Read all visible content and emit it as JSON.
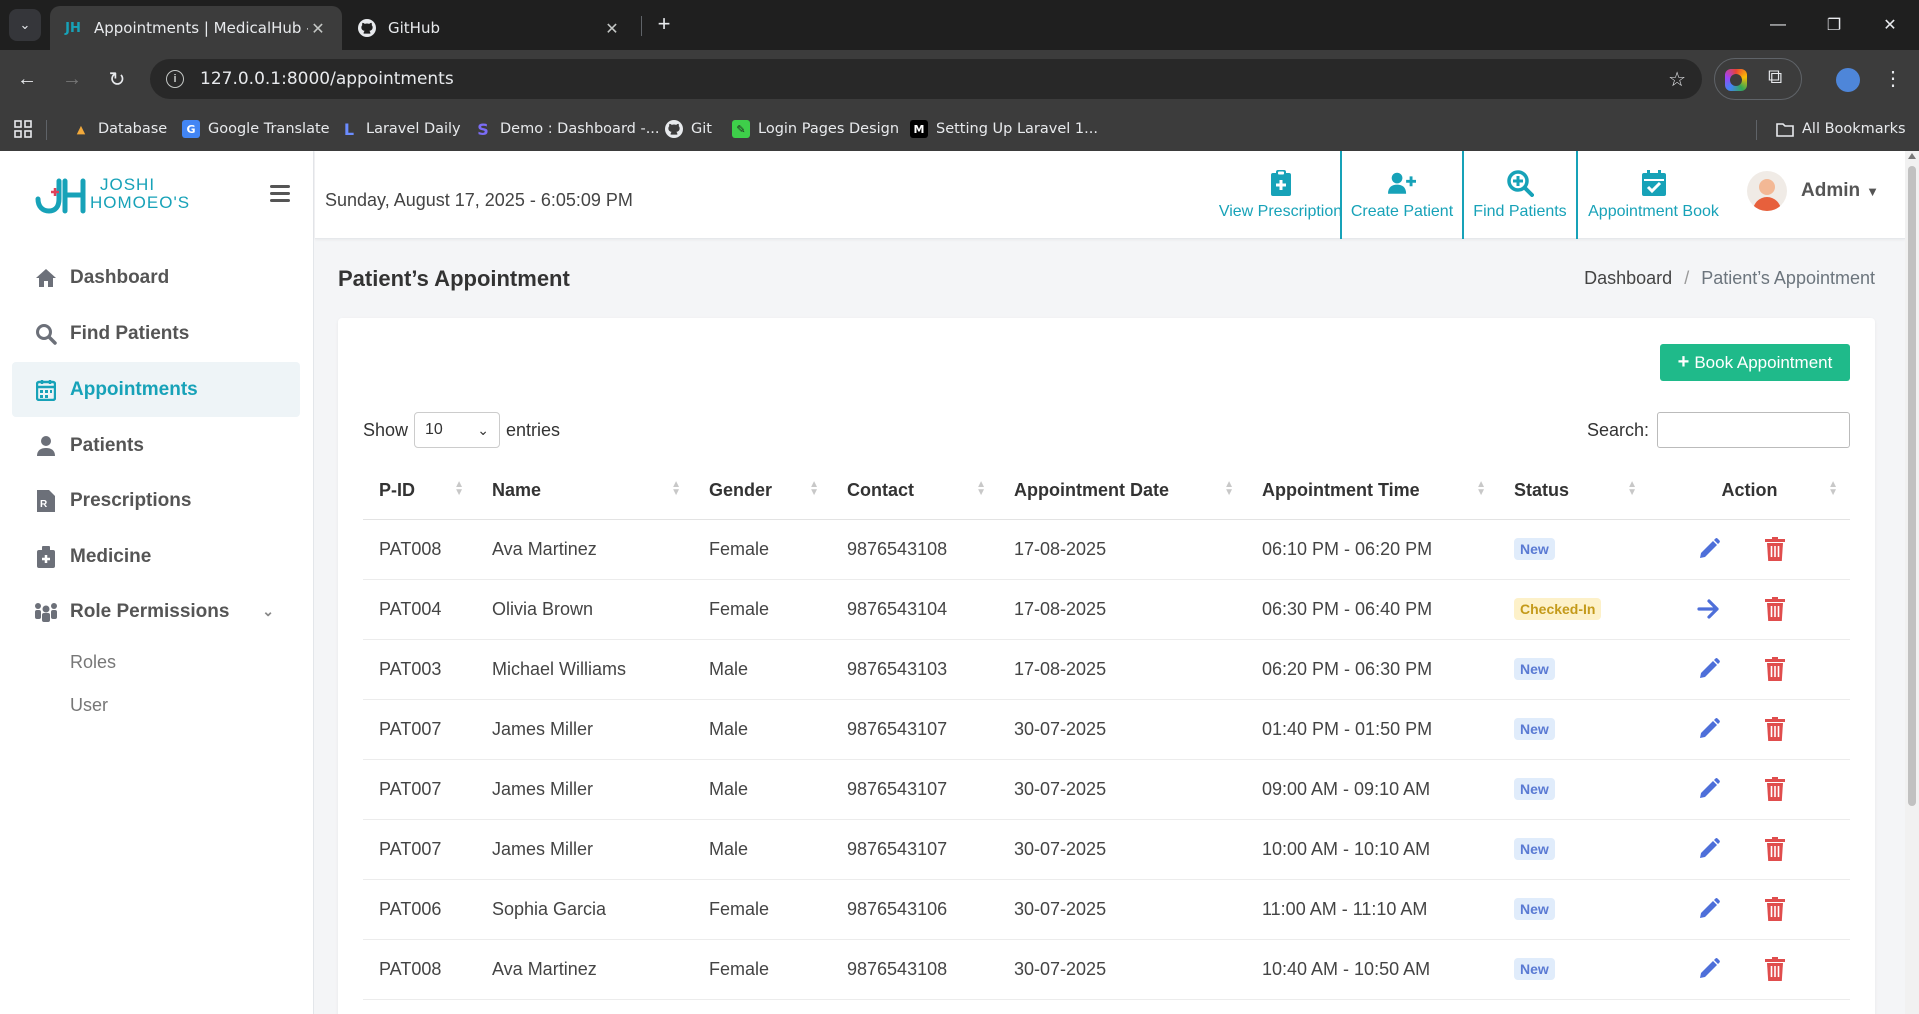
{
  "browser": {
    "tabs": [
      {
        "title": "Appointments | MedicalHub - A",
        "favicon": "jh-logo-icon"
      },
      {
        "title": "GitHub",
        "favicon": "github-icon"
      }
    ],
    "url": "127.0.0.1:8000/appointments",
    "bookmarks": [
      {
        "label": "Database",
        "icon": "database-icon"
      },
      {
        "label": "Google Translate",
        "icon": "translate-icon"
      },
      {
        "label": "Laravel Daily",
        "icon": "laravel-icon"
      },
      {
        "label": "Demo : Dashboard -...",
        "icon": "demo-icon"
      },
      {
        "label": "Git",
        "icon": "github-icon"
      },
      {
        "label": "Login Pages Design",
        "icon": "login-icon"
      },
      {
        "label": "Setting Up Laravel 1...",
        "icon": "medium-icon"
      }
    ],
    "all_bookmarks": "All Bookmarks"
  },
  "brand": {
    "line1": "JOSHI",
    "line2": "HOMOEO'S"
  },
  "sidebar": {
    "items": [
      {
        "label": "Dashboard",
        "icon": "home-icon"
      },
      {
        "label": "Find Patients",
        "icon": "search-icon"
      },
      {
        "label": "Appointments",
        "icon": "calendar-icon"
      },
      {
        "label": "Patients",
        "icon": "user-icon"
      },
      {
        "label": "Prescriptions",
        "icon": "prescription-icon"
      },
      {
        "label": "Medicine",
        "icon": "medkit-icon"
      },
      {
        "label": "Role Permissions",
        "icon": "people-icon"
      }
    ],
    "subitems": [
      {
        "label": "Roles"
      },
      {
        "label": "User"
      }
    ]
  },
  "topbar": {
    "datetime": "Sunday, August 17, 2025 - 6:05:09 PM",
    "actions": [
      {
        "label": "View Prescription",
        "icon": "clipboard-plus-icon"
      },
      {
        "label": "Create Patient",
        "icon": "user-plus-icon"
      },
      {
        "label": "Find Patients",
        "icon": "search-plus-icon"
      },
      {
        "label": "Appointment Book",
        "icon": "calendar-check-icon"
      }
    ],
    "user": "Admin"
  },
  "page": {
    "title": "Patient’s Appointment",
    "breadcrumb": {
      "home": "Dashboard",
      "separator": "/",
      "current": "Patient’s Appointment"
    },
    "book_button": "Book Appointment",
    "show_label": "Show",
    "entries_value": "10",
    "entries_label": "entries",
    "search_label": "Search:"
  },
  "table": {
    "columns": [
      "P-ID",
      "Name",
      "Gender",
      "Contact",
      "Appointment Date",
      "Appointment Time",
      "Status",
      "Action"
    ],
    "rows": [
      {
        "pid": "PAT008",
        "name": "Ava Martinez",
        "gender": "Female",
        "contact": "9876543108",
        "date": "17-08-2025",
        "time": "06:10 PM - 06:20 PM",
        "status": "New",
        "action": "edit"
      },
      {
        "pid": "PAT004",
        "name": "Olivia Brown",
        "gender": "Female",
        "contact": "9876543104",
        "date": "17-08-2025",
        "time": "06:30 PM - 06:40 PM",
        "status": "Checked-In",
        "action": "arrow"
      },
      {
        "pid": "PAT003",
        "name": "Michael Williams",
        "gender": "Male",
        "contact": "9876543103",
        "date": "17-08-2025",
        "time": "06:20 PM - 06:30 PM",
        "status": "New",
        "action": "edit"
      },
      {
        "pid": "PAT007",
        "name": "James Miller",
        "gender": "Male",
        "contact": "9876543107",
        "date": "30-07-2025",
        "time": "01:40 PM - 01:50 PM",
        "status": "New",
        "action": "edit"
      },
      {
        "pid": "PAT007",
        "name": "James Miller",
        "gender": "Male",
        "contact": "9876543107",
        "date": "30-07-2025",
        "time": "09:00 AM - 09:10 AM",
        "status": "New",
        "action": "edit"
      },
      {
        "pid": "PAT007",
        "name": "James Miller",
        "gender": "Male",
        "contact": "9876543107",
        "date": "30-07-2025",
        "time": "10:00 AM - 10:10 AM",
        "status": "New",
        "action": "edit"
      },
      {
        "pid": "PAT006",
        "name": "Sophia Garcia",
        "gender": "Female",
        "contact": "9876543106",
        "date": "30-07-2025",
        "time": "11:00 AM - 11:10 AM",
        "status": "New",
        "action": "edit"
      },
      {
        "pid": "PAT008",
        "name": "Ava Martinez",
        "gender": "Female",
        "contact": "9876543108",
        "date": "30-07-2025",
        "time": "10:40 AM - 10:50 AM",
        "status": "New",
        "action": "edit"
      }
    ]
  },
  "colors": {
    "accent": "#17a2b8",
    "success": "#1fba8a",
    "edit": "#4e6fd9",
    "delete": "#e04d4d"
  }
}
